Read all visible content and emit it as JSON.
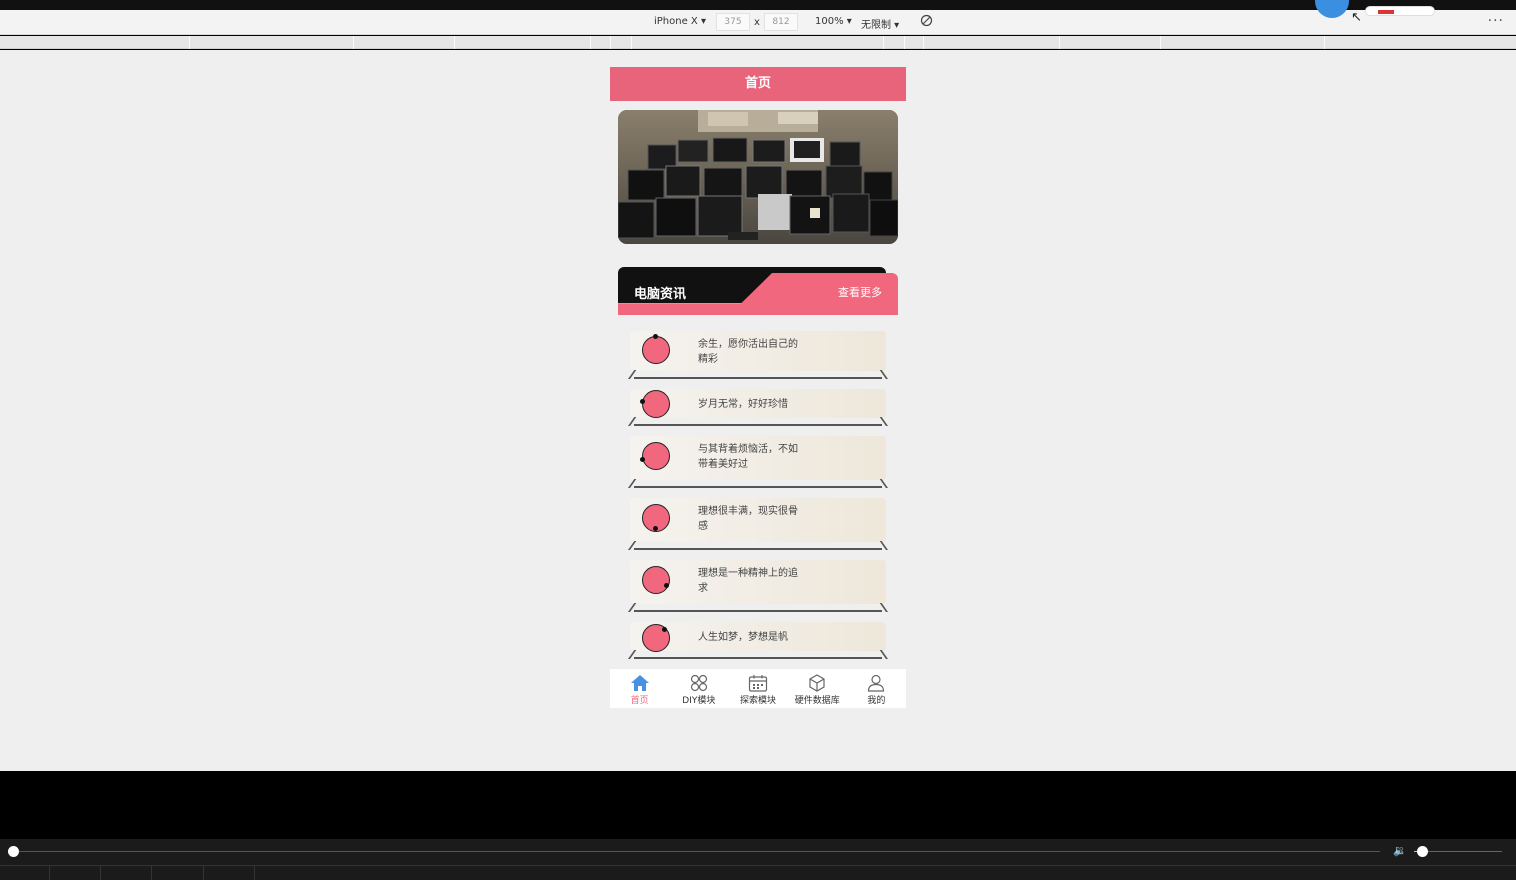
{
  "devtools": {
    "device": "iPhone X ▾",
    "width": "375",
    "times": "x",
    "height": "812",
    "zoom": "100% ▾",
    "throttle": "无限制 ▾",
    "more": "···"
  },
  "page": {
    "header_title": "首页",
    "section_title": "电脑资讯",
    "section_more": "查看更多",
    "news": [
      {
        "line1": "余生，愿你活出自己的",
        "line2": "精彩"
      },
      {
        "line1": "岁月无常，好好珍惜",
        "line2": ""
      },
      {
        "line1": "与其背着烦恼活，不如",
        "line2": "带着美好过"
      },
      {
        "line1": "理想很丰满，现实很骨",
        "line2": "感"
      },
      {
        "line1": "理想是一种精神上的追",
        "line2": "求"
      },
      {
        "line1": "人生如梦，梦想是帆",
        "line2": ""
      }
    ],
    "tabs": [
      {
        "label": "首页",
        "icon": "home-icon",
        "active": true
      },
      {
        "label": "DIY模块",
        "icon": "grid-icon",
        "active": false
      },
      {
        "label": "探索模块",
        "icon": "calendar-icon",
        "active": false
      },
      {
        "label": "硬件数据库",
        "icon": "cube-icon",
        "active": false
      },
      {
        "label": "我的",
        "icon": "user-icon",
        "active": false
      }
    ]
  },
  "colors": {
    "accent": "#f0677e",
    "header": "#e8647a",
    "active_tab_icon": "#4a90e2"
  }
}
